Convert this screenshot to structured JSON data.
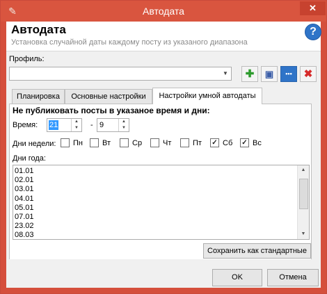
{
  "window": {
    "title": "Автодата",
    "close_glyph": "✕",
    "app_icon": "app-icon"
  },
  "header": {
    "title": "Автодата",
    "subtitle": "Установка случайной даты каждому посту из указаного диапазона",
    "help_glyph": "?"
  },
  "profile": {
    "label": "Профиль:",
    "value": "",
    "buttons": [
      {
        "icon": "add-icon",
        "glyph": "✚",
        "color": "#2e9b2e"
      },
      {
        "icon": "save-icon",
        "glyph": "▣",
        "color": "#3b5ea8"
      },
      {
        "icon": "more-icon",
        "glyph": "•••",
        "color": "#2f74c8"
      },
      {
        "icon": "delete-icon",
        "glyph": "✖",
        "color": "#d62a2a"
      }
    ]
  },
  "tabs": [
    {
      "label": "Планировка"
    },
    {
      "label": "Основные настройки"
    },
    {
      "label": "Настройки умной автодаты"
    }
  ],
  "smart": {
    "heading": "Не публиковать посты в указаное время и дни:",
    "time_label": "Время:",
    "time_from": "21",
    "time_to": "9",
    "dash": "-",
    "days_label": "Дни недели:",
    "days": [
      {
        "label": "Пн",
        "checked": false,
        "mark": ""
      },
      {
        "label": "Вт",
        "checked": false,
        "mark": ""
      },
      {
        "label": "Ср",
        "checked": false,
        "mark": ""
      },
      {
        "label": "Чт",
        "checked": false,
        "mark": ""
      },
      {
        "label": "Пт",
        "checked": false,
        "mark": ""
      },
      {
        "label": "Сб",
        "checked": true,
        "mark": "✓"
      },
      {
        "label": "Вс",
        "checked": true,
        "mark": "✓"
      }
    ],
    "year_label": "Дни года:",
    "dates": [
      "01.01",
      "02.01",
      "03.01",
      "04.01",
      "05.01",
      "07.01",
      "23.02",
      "08.03"
    ],
    "save_default": "Сохранить как стандартные"
  },
  "footer": {
    "ok": "OK",
    "cancel": "Отмена"
  },
  "colors": {
    "titlebar": "#d9553f",
    "selection": "#3399ff"
  }
}
